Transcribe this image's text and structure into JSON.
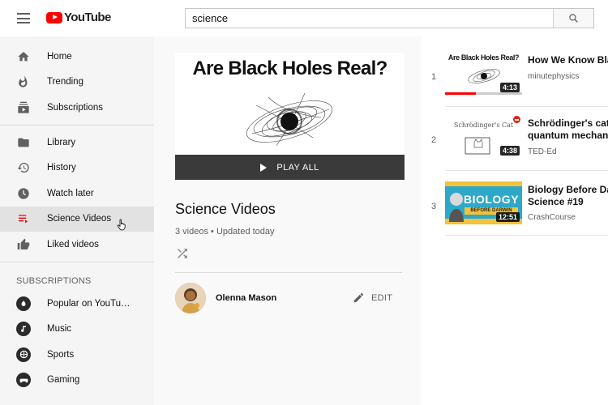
{
  "header": {
    "logo_text": "YouTube",
    "search_value": "science"
  },
  "sidebar": {
    "main_items": [
      {
        "label": "Home",
        "icon": "home-icon"
      },
      {
        "label": "Trending",
        "icon": "flame-icon"
      },
      {
        "label": "Subscriptions",
        "icon": "subscriptions-icon"
      }
    ],
    "library_items": [
      {
        "label": "Library",
        "icon": "folder-icon"
      },
      {
        "label": "History",
        "icon": "history-icon"
      },
      {
        "label": "Watch later",
        "icon": "clock-icon"
      },
      {
        "label": "Science Videos",
        "icon": "playlist-icon",
        "active": true
      },
      {
        "label": "Liked videos",
        "icon": "thumbs-up-icon"
      }
    ],
    "subscriptions_header": "SUBSCRIPTIONS",
    "subscriptions": [
      {
        "label": "Popular on YouTu…",
        "icon": "popular-icon"
      },
      {
        "label": "Music",
        "icon": "music-icon"
      },
      {
        "label": "Sports",
        "icon": "sports-icon"
      },
      {
        "label": "Gaming",
        "icon": "gaming-icon"
      }
    ]
  },
  "playlist": {
    "hero_title": "Are Black Holes Real?",
    "play_all": "PLAY ALL",
    "title": "Science Videos",
    "video_count": "3 videos",
    "updated": "Updated today",
    "owner": "Olenna Mason",
    "edit_label": "EDIT"
  },
  "videos": [
    {
      "index": "1",
      "title": "How We Know Bla",
      "channel": "minutephysics",
      "duration": "4:13",
      "thumb_text": "Are Black Holes Real?",
      "watched_fraction": 0.4
    },
    {
      "index": "2",
      "title_line1": "Schrödinger's cat:",
      "title_line2": "quantum mechan",
      "channel": "TED-Ed",
      "duration": "4:38",
      "thumb_text": "Schrödinger's Cat"
    },
    {
      "index": "3",
      "title_line1": "Biology Before Da",
      "title_line2": "Science #19",
      "channel": "CrashCourse",
      "duration": "12:51",
      "thumb_text_1": "BIOLOGY",
      "thumb_text_2": "BEFORE DARWIN"
    }
  ],
  "colors": {
    "brand_red": "#ff0000",
    "sidebar_bg": "#f5f5f5",
    "active_bg": "#e2e2e2",
    "main_bg": "#f9f9f9"
  }
}
